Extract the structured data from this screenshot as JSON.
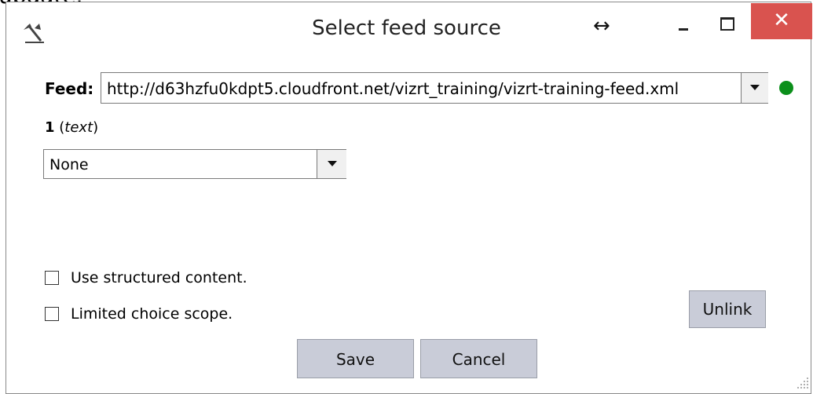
{
  "top_crop_text": "update.",
  "window": {
    "title": "Select feed source",
    "icons": {
      "app": "cursor-tool-icon",
      "resize": "resize-horizontal-icon",
      "minimize": "minimize-icon",
      "maximize": "maximize-icon",
      "close": "close-icon"
    },
    "resize_glyph": "↔",
    "close_glyph": "✕",
    "close_color": "#d9534f"
  },
  "feed": {
    "label": "Feed:",
    "url": "http://d63hzfu0kdpt5.cloudfront.net/vizrt_training/vizrt-training-feed.xml",
    "status_color": "#0b8f1a"
  },
  "field": {
    "number": "1",
    "type": "text",
    "selected": "None"
  },
  "options": {
    "structured_label": "Use structured content.",
    "structured_checked": false,
    "limited_label": "Limited choice scope.",
    "limited_checked": false
  },
  "buttons": {
    "unlink": "Unlink",
    "save": "Save",
    "cancel": "Cancel"
  }
}
